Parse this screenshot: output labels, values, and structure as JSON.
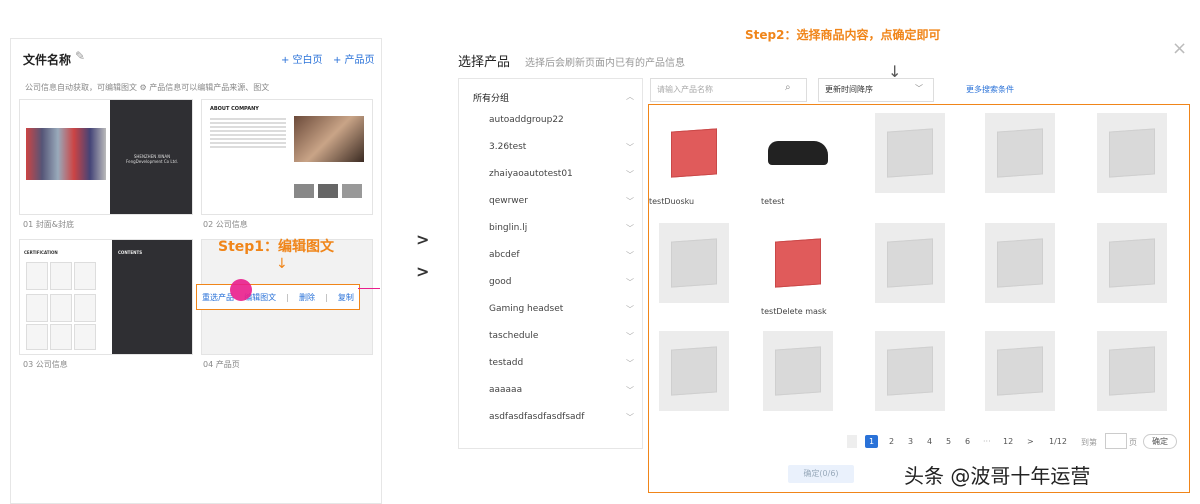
{
  "left": {
    "title": "文件名称",
    "add_blank": "+ 空白页",
    "add_product": "+ 产品页",
    "info_line": "公司信息自动获取，可编辑图文  ⚙ 产品信息可以编辑产品来源、图文",
    "thumbs": [
      {
        "caption": "01 封面&封底",
        "company": "SHENZHEN XINAN FengDevelopment Co Ltd."
      },
      {
        "caption": "02 公司信息",
        "about": "ABOUT COMPANY"
      },
      {
        "caption": "03 公司信息",
        "cert": "CERTIFICATION",
        "contents": "CONTENTS"
      },
      {
        "caption": "04 产品页"
      }
    ],
    "step1": "Step1：编辑图文",
    "edit_actions": [
      "重选产品",
      "编辑图文",
      "删除",
      "复制"
    ]
  },
  "chevrons": [
    ">",
    ">"
  ],
  "dialog": {
    "title": "选择产品",
    "subtitle": "选择后会刷新页面内已有的产品信息",
    "step2": "Step2：选择商品内容，点确定即可",
    "close": "×",
    "categories_header": "所有分组",
    "categories": [
      "autoaddgroup22",
      "3.26test",
      "zhaiyaoautotest01",
      "qewrwer",
      "binglin.lj",
      "abcdef",
      "good",
      "Gaming headset",
      "taschedule",
      "testadd",
      "aaaaaa",
      "asdfasdfasdfasdfsadf"
    ],
    "search_placeholder": "请输入产品名称",
    "sort_value": "更新时间降序",
    "more_filters": "更多搜索条件",
    "products": [
      {
        "name": "testDuosku",
        "kind": "red-cube"
      },
      {
        "name": "tetest",
        "kind": "car"
      },
      {
        "name": "",
        "kind": "gray-cube"
      },
      {
        "name": "",
        "kind": "gray-cube"
      },
      {
        "name": "",
        "kind": "gray-cube"
      },
      {
        "name": "",
        "kind": "gray-cube"
      },
      {
        "name": "testDelete mask",
        "kind": "red-cube"
      },
      {
        "name": "",
        "kind": "box"
      },
      {
        "name": "",
        "kind": "gray-cube"
      },
      {
        "name": "",
        "kind": "gray-cube"
      },
      {
        "name": "",
        "kind": "gray-cube"
      },
      {
        "name": "",
        "kind": "gray-cube"
      },
      {
        "name": "",
        "kind": "gray-cube"
      },
      {
        "name": "",
        "kind": "gray-cube"
      },
      {
        "name": "",
        "kind": "gray-cube"
      }
    ],
    "pagination": {
      "pages": [
        "1",
        "2",
        "3",
        "4",
        "5",
        "6",
        "···",
        "12"
      ],
      "current": "1",
      "next": ">",
      "total": "1/12",
      "goto": "到第",
      "page_unit": "页",
      "confirm": "确定"
    },
    "confirm_button": "确定(0/6)"
  },
  "watermark": "头条 @波哥十年运营",
  "colors": {
    "accent": "#f08519",
    "link": "#2a72d8",
    "red_cube": "#e05b5b"
  }
}
